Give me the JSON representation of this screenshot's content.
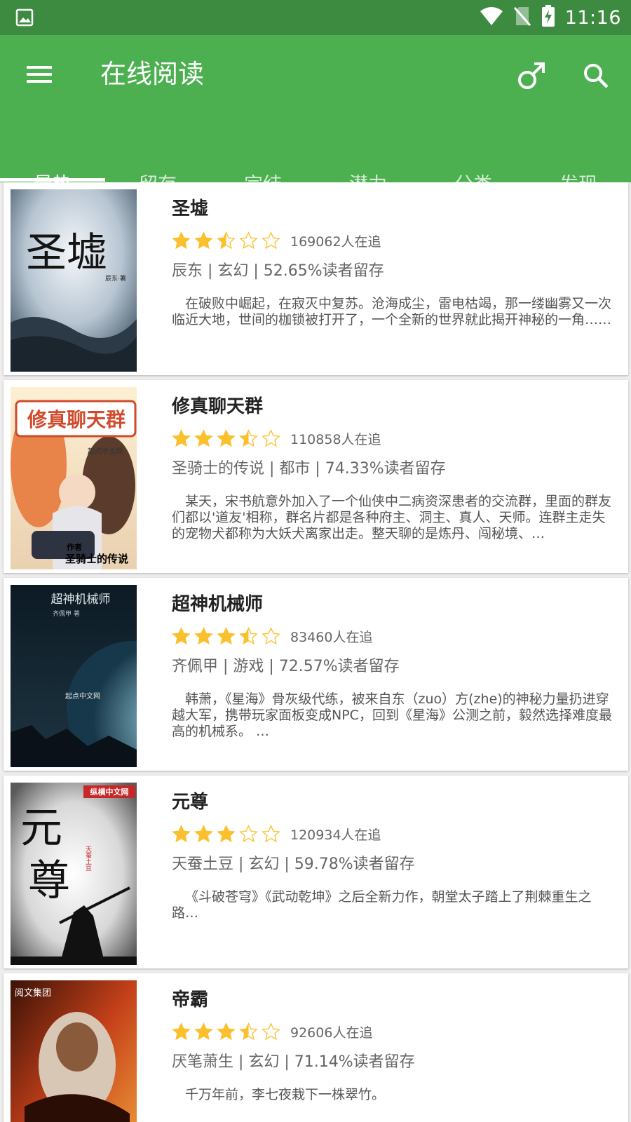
{
  "status_bar": {
    "time": "11:16",
    "icons": [
      "image-notification-icon",
      "wifi-icon",
      "no-sim-icon",
      "battery-charging-icon"
    ]
  },
  "app_bar": {
    "title": "在线阅读",
    "icons": [
      "menu-icon",
      "male-gender-icon",
      "search-icon"
    ]
  },
  "tabs": [
    {
      "label": "最热",
      "active": true
    },
    {
      "label": "留存",
      "active": false
    },
    {
      "label": "完结",
      "active": false
    },
    {
      "label": "潜力",
      "active": false
    },
    {
      "label": "分类",
      "active": false
    },
    {
      "label": "发现",
      "active": false
    }
  ],
  "colors": {
    "primary": "#4caf50",
    "primary_dark": "#3d8b40",
    "star": "#fbc02d"
  },
  "books": [
    {
      "title": "圣墟",
      "rating": 2.5,
      "followers": "169062人在追",
      "meta": "辰东 | 玄幻 | 52.65%读者留存",
      "desc": "在破败中崛起，在寂灭中复苏。沧海成尘，雷电枯竭，那一缕幽雾又一次临近大地，世间的枷锁被打开了，一个全新的世界就此揭开神秘的一角……",
      "cover_text": [
        "圣墟",
        "辰东·著"
      ]
    },
    {
      "title": "修真聊天群",
      "rating": 3.5,
      "followers": "110858人在追",
      "meta": "圣骑士的传说 | 都市 | 74.33%读者留存",
      "desc": "某天，宋书航意外加入了一个仙侠中二病资深患者的交流群，里面的群友们都以'道友'相称，群名片都是各种府主、洞主、真人、天师。连群主走失的宠物犬都称为大妖犬离家出走。整天聊的是炼丹、闯秘境、…",
      "cover_text": [
        "修真聊天群",
        "起点中文网",
        "作者",
        "圣骑士的传说"
      ]
    },
    {
      "title": "超神机械师",
      "rating": 3.5,
      "followers": "83460人在追",
      "meta": "齐佩甲 | 游戏 | 72.57%读者留存",
      "desc": "韩萧，《星海》骨灰级代练，被来自东（zuo）方(zhe)的神秘力量扔进穿越大军，携带玩家面板变成NPC，回到《星海》公测之前，毅然选择难度最高的机械系。 …",
      "cover_text": [
        "超神机械师",
        "齐佩甲 著",
        "起点中文网"
      ]
    },
    {
      "title": "元尊",
      "rating": 3,
      "followers": "120934人在追",
      "meta": "天蚕土豆 | 玄幻 | 59.78%读者留存",
      "desc": "《斗破苍穹》《武动乾坤》之后全新力作，朝堂太子踏上了荆棘重生之路…",
      "cover_text": [
        "纵横中文网",
        "元",
        "尊",
        "天蚕土豆"
      ]
    },
    {
      "title": "帝霸",
      "rating": 3.5,
      "followers": "92606人在追",
      "meta": "厌笔萧生 | 玄幻 | 71.14%读者留存",
      "desc": "千万年前，李七夜栽下一株翠竹。",
      "cover_text": [
        "阅文集团"
      ]
    }
  ]
}
